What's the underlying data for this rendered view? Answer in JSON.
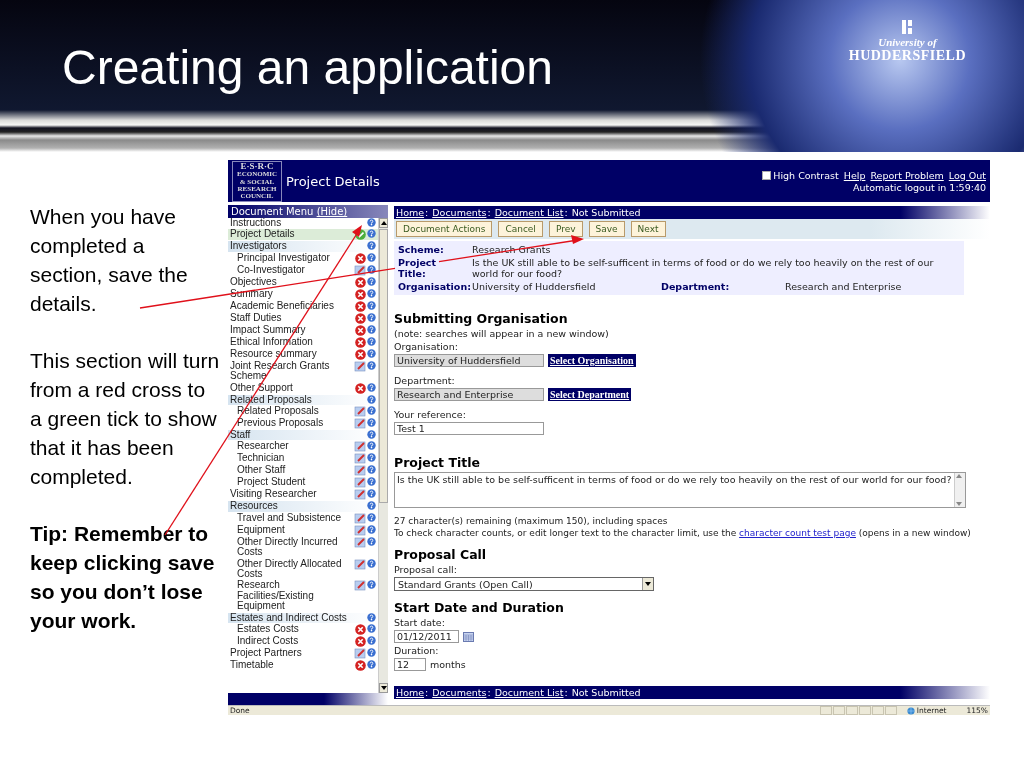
{
  "slide": {
    "title": "Creating an application",
    "logo": {
      "line_1": "University of",
      "line_2": "HUDDERSFIELD"
    },
    "notes": [
      {
        "kind": "body",
        "text": "When you have completed a section, save the details."
      },
      {
        "kind": "body",
        "text": "This section will turn from a red cross to a green tick to show that it has been completed."
      },
      {
        "kind": "tip",
        "text": "Tip: Remember to keep clicking save so you don’t lose your work."
      }
    ]
  },
  "screen": {
    "header": {
      "logo_lines": [
        "E·S·R·C",
        "ECONOMIC",
        "& SOCIAL",
        "RESEARCH",
        "COUNCIL"
      ],
      "page_title": "Project Details",
      "high_contrast": {
        "label": "High Contrast",
        "checked": false
      },
      "links": [
        "Help",
        "Report Problem",
        "Log Out"
      ],
      "logout_notice": "Automatic logout in 1:59:40"
    },
    "menu": {
      "title": "Document Menu",
      "hide_link": "(Hide)",
      "items": [
        {
          "label": "Instructions",
          "kind": "plain",
          "selected": false
        },
        {
          "label": "Project Details",
          "kind": "complete",
          "selected": true
        },
        {
          "label": "Investigators",
          "kind": "plain",
          "selected": false,
          "children": [
            {
              "label": "Principal Investigator",
              "kind": "error",
              "selected": false
            },
            {
              "label": "Co-Investigator",
              "kind": "edit",
              "selected": false
            }
          ]
        },
        {
          "label": "Objectives",
          "kind": "error",
          "selected": false
        },
        {
          "label": "Summary",
          "kind": "error",
          "selected": false
        },
        {
          "label": "Academic Beneficiaries",
          "kind": "error",
          "selected": false
        },
        {
          "label": "Staff Duties",
          "kind": "error",
          "selected": false
        },
        {
          "label": "Impact Summary",
          "kind": "error",
          "selected": false
        },
        {
          "label": "Ethical Information",
          "kind": "error",
          "selected": false
        },
        {
          "label": "Resource summary",
          "kind": "error",
          "selected": false
        },
        {
          "label": "Joint Research Grants Scheme",
          "kind": "edit",
          "selected": false
        },
        {
          "label": "Other Support",
          "kind": "error",
          "selected": false
        },
        {
          "label": "Related Proposals",
          "kind": "plain",
          "selected": false,
          "children": [
            {
              "label": "Related Proposals",
              "kind": "edit",
              "selected": false
            },
            {
              "label": "Previous Proposals",
              "kind": "edit",
              "selected": false
            }
          ]
        },
        {
          "label": "Staff",
          "kind": "plain",
          "selected": false,
          "children": [
            {
              "label": "Researcher",
              "kind": "edit",
              "selected": false
            },
            {
              "label": "Technician",
              "kind": "edit",
              "selected": false
            },
            {
              "label": "Other Staff",
              "kind": "edit",
              "selected": false
            },
            {
              "label": "Project Student",
              "kind": "edit",
              "selected": false
            }
          ]
        },
        {
          "label": "Visiting Researcher",
          "kind": "edit",
          "selected": false
        },
        {
          "label": "Resources",
          "kind": "plain",
          "selected": false,
          "children": [
            {
              "label": "Travel and Subsistence",
              "kind": "edit",
              "selected": false
            },
            {
              "label": "Equipment",
              "kind": "edit",
              "selected": false
            },
            {
              "label": "Other Directly Incurred Costs",
              "kind": "edit",
              "selected": false
            },
            {
              "label": "Other Directly Allocated Costs",
              "kind": "edit",
              "selected": false
            },
            {
              "label": "Research Facilities/Existing Equipment",
              "kind": "edit",
              "selected": false
            }
          ]
        },
        {
          "label": "Estates and Indirect Costs",
          "kind": "plain",
          "selected": false,
          "children": [
            {
              "label": "Estates Costs",
              "kind": "error",
              "selected": false
            },
            {
              "label": "Indirect Costs",
              "kind": "error",
              "selected": false
            }
          ]
        },
        {
          "label": "Project Partners",
          "kind": "edit",
          "selected": false
        },
        {
          "label": "Timetable",
          "kind": "error",
          "selected": false
        }
      ]
    },
    "breadcrumb_top": {
      "links": [
        "Home",
        "Documents",
        "Document List"
      ],
      "separator": ":",
      "status": "Not Submitted"
    },
    "toolbar": [
      "Document Actions",
      "Cancel",
      "Prev",
      "Save",
      "Next"
    ],
    "summary": {
      "scheme_label": "Scheme:",
      "scheme": "Research Grants",
      "title_label": "Project Title:",
      "title": "Is the UK still able to be self-sufficent in terms of food or do we rely too heavily on the rest of our world for our food?",
      "organisation_label": "Organisation:",
      "organisation": "University of Huddersfield",
      "department_label": "Department:",
      "department": "Research and Enterprise"
    },
    "submitting_organisation": {
      "heading": "Submitting Organisation",
      "note": "(note: searches will appear in a new window)",
      "organisation_label": "Organisation:",
      "organisation": "University of Huddersfield",
      "organisation_button": "Select Organisation",
      "department_label": "Department:",
      "department": "Research and Enterprise",
      "department_button": "Select Department",
      "reference_label": "Your reference:",
      "reference": "Test 1"
    },
    "project_title": {
      "heading": "Project Title",
      "value": "Is the UK still able to be self-sufficent in terms of food or do we rely too heavily on the rest of our world for our food?",
      "remaining": "27 character(s) remaining (maximum 150), including spaces",
      "help_before": "To check character counts, or edit longer text to the character limit, use the",
      "help_link": "character count test page",
      "help_after": "(opens in a new window)"
    },
    "proposal_call": {
      "heading": "Proposal Call",
      "label": "Proposal call:",
      "value": "Standard Grants (Open Call)"
    },
    "start_date": {
      "heading": "Start Date and Duration",
      "date_label": "Start date:",
      "date": "01/12/2011",
      "duration_label": "Duration:",
      "duration": "12",
      "unit": "months"
    },
    "breadcrumb_bottom": {
      "links": [
        "Home",
        "Documents",
        "Document List"
      ],
      "separator": ":",
      "status": "Not Submitted"
    },
    "status_bar": {
      "text": "Done",
      "zone": "Internet",
      "zoom": "115%"
    }
  }
}
